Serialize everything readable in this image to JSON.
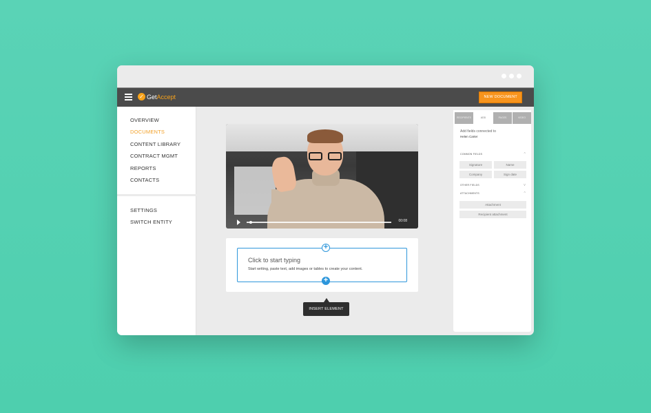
{
  "window": {
    "titlebar_dots": 3
  },
  "appbar": {
    "menu_icon": "hamburger-icon",
    "logo": {
      "prefix": "Get",
      "suffix": "Accept",
      "badge": "✓"
    },
    "new_document_label": "NEW DOCUMENT"
  },
  "sidebar": {
    "items": [
      {
        "label": "OVERVIEW",
        "active": false
      },
      {
        "label": "DOCUMENTS",
        "active": true
      },
      {
        "label": "CONTENT LIBRARY",
        "active": false
      },
      {
        "label": "CONTRACT MGMT",
        "active": false
      },
      {
        "label": "REPORTS",
        "active": false
      },
      {
        "label": "CONTACTS",
        "active": false
      }
    ],
    "secondary_items": [
      {
        "label": "SETTINGS"
      },
      {
        "label": "SWITCH ENTITY"
      }
    ]
  },
  "main": {
    "video": {
      "time": "00:08",
      "progress": 0.02
    },
    "editor": {
      "title": "Click to start typing",
      "subtitle": "Start writing, paste text, add images or tables to create your content.",
      "plus_symbol": "+"
    },
    "tooltip": "INSERT ELEMENT"
  },
  "panel": {
    "tabs": [
      {
        "label": "RECIPIENTS",
        "active": false
      },
      {
        "label": "ADD",
        "active": true
      },
      {
        "label": "PAGES",
        "active": false
      },
      {
        "label": "VIDEO",
        "active": false
      }
    ],
    "connected_label": "Add fields connected to",
    "recipient_name": "Helen Carter",
    "sections": {
      "common_fields": {
        "title": "COMMON FIELDS",
        "expanded": true,
        "chevron": "^",
        "fields": [
          "Signature",
          "Name",
          "Company",
          "Sign date"
        ]
      },
      "other_fields": {
        "title": "OTHER FIELDS",
        "expanded": false,
        "chevron": "v"
      },
      "attachments": {
        "title": "ATTACHMENTS",
        "expanded": true,
        "chevron": "^",
        "fields": [
          "Attachment",
          "Recipient attachment"
        ]
      }
    }
  },
  "colors": {
    "background": "#55d2b2",
    "appbar": "#4b4b4b",
    "accent_orange": "#f7941d",
    "active_nav": "#f2a12a",
    "editor_blue": "#2d96db"
  }
}
